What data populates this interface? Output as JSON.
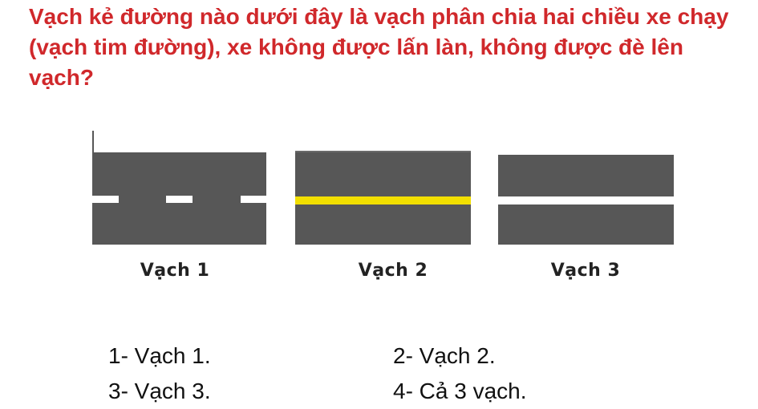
{
  "question": "Vạch kẻ đường nào dưới đây là vạch phân chia hai chiều xe chạy (vạch tim đường), xe không được lấn làn, không được đè lên vạch?",
  "lanes": [
    {
      "label": "Vạch 1",
      "line_type": "dashed-white"
    },
    {
      "label": "Vạch 2",
      "line_type": "solid-yellow"
    },
    {
      "label": "Vạch 3",
      "line_type": "solid-white"
    }
  ],
  "answers": [
    "1- Vạch 1.",
    "2- Vạch 2.",
    "3- Vạch 3.",
    "4- Cả 3 vạch."
  ],
  "colors": {
    "question_text": "#d0282b",
    "road": "#575757",
    "yellow_line": "#f2df00",
    "white_line": "#ffffff"
  }
}
